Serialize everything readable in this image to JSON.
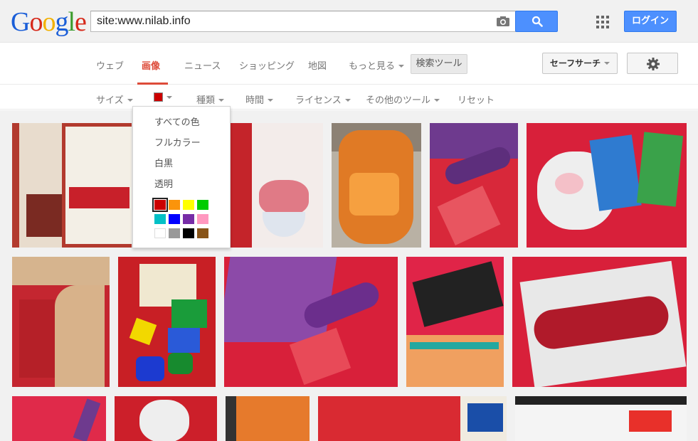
{
  "logo": {
    "text": "Google"
  },
  "search": {
    "query": "site:www.nilab.info"
  },
  "header": {
    "login_label": "ログイン"
  },
  "nav": {
    "tabs": [
      {
        "label": "ウェブ"
      },
      {
        "label": "画像"
      },
      {
        "label": "ニュース"
      },
      {
        "label": "ショッピング"
      },
      {
        "label": "地図"
      },
      {
        "label": "もっと見る"
      }
    ],
    "search_tools_label": "検索ツール",
    "safesearch_label": "セーフサーチ"
  },
  "tools": {
    "size_label": "サイズ",
    "type_label": "種類",
    "time_label": "時間",
    "license_label": "ライセンス",
    "other_label": "その他のツール",
    "reset_label": "リセット",
    "selected_color": "#cc0000"
  },
  "color_menu": {
    "items": [
      {
        "label": "すべての色"
      },
      {
        "label": "フルカラー"
      },
      {
        "label": "白黒"
      },
      {
        "label": "透明"
      }
    ],
    "swatches": [
      {
        "name": "red",
        "hex": "#cc0000",
        "selected": true
      },
      {
        "name": "orange",
        "hex": "#fb940b"
      },
      {
        "name": "yellow",
        "hex": "#ffff00"
      },
      {
        "name": "green",
        "hex": "#00cc00"
      },
      {
        "name": "teal",
        "hex": "#03c0c6"
      },
      {
        "name": "blue",
        "hex": "#0000ff"
      },
      {
        "name": "purple",
        "hex": "#762ca7"
      },
      {
        "name": "pink",
        "hex": "#ff98bf"
      },
      {
        "name": "white",
        "hex": "#ffffff"
      },
      {
        "name": "gray",
        "hex": "#999999"
      },
      {
        "name": "black",
        "hex": "#000000"
      },
      {
        "name": "brown",
        "hex": "#885418"
      }
    ]
  },
  "icons": {
    "camera": "camera-icon",
    "search": "search-icon",
    "apps": "apps-grid-icon",
    "settings": "gear-icon"
  }
}
